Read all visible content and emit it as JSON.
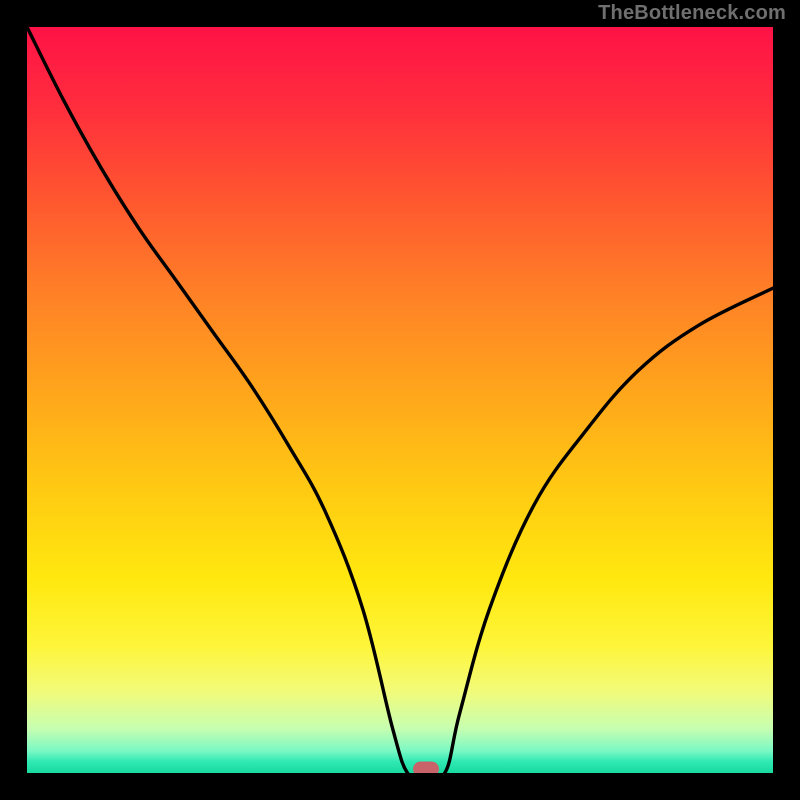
{
  "watermark": "TheBottleneck.com",
  "colors": {
    "frame": "#000000",
    "watermark": "#6f6f6f",
    "curve": "#000000",
    "marker": "#c86469",
    "gradient_stops": [
      "#ff1246",
      "#ff2b3e",
      "#ff5330",
      "#ff7e27",
      "#ffa31c",
      "#ffca12",
      "#ffe80f",
      "#fef53a",
      "#f2fb79",
      "#c7feb0",
      "#7cf8c4",
      "#2fe9b3",
      "#18da9f"
    ]
  },
  "chart_data": {
    "type": "line",
    "title": "",
    "xlabel": "",
    "ylabel": "",
    "xlim": [
      0,
      1
    ],
    "ylim": [
      0,
      1
    ],
    "note": "Axes are normalized 0–1 (no tick labels in source). y-value maps to a red→green gradient (1=red/top, 0=green/bottom). Curve shows a V-shaped dip to ~0 near x≈0.53.",
    "x": [
      0.0,
      0.05,
      0.1,
      0.15,
      0.2,
      0.25,
      0.3,
      0.35,
      0.4,
      0.45,
      0.49,
      0.51,
      0.53,
      0.56,
      0.58,
      0.62,
      0.68,
      0.75,
      0.82,
      0.9,
      1.0
    ],
    "values": [
      1.0,
      0.9,
      0.81,
      0.73,
      0.66,
      0.59,
      0.52,
      0.44,
      0.35,
      0.22,
      0.06,
      0.0,
      0.0,
      0.0,
      0.08,
      0.22,
      0.36,
      0.46,
      0.54,
      0.6,
      0.65
    ],
    "marker": {
      "x": 0.535,
      "y": 0.005
    }
  }
}
